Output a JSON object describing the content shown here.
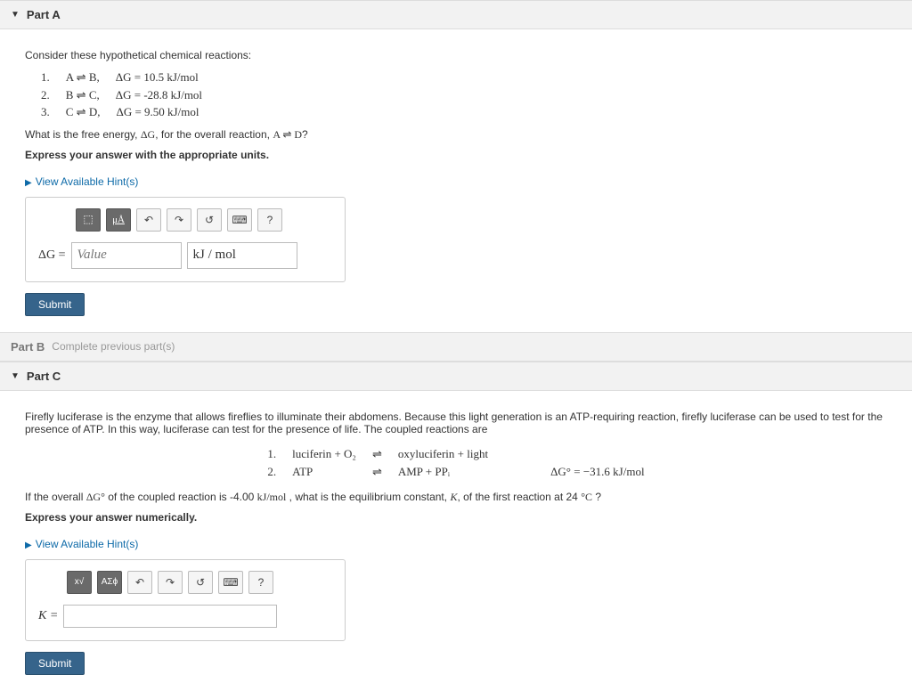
{
  "partA": {
    "title": "Part A",
    "intro": "Consider these hypothetical chemical reactions:",
    "reactions": [
      {
        "num": "1.",
        "lhs": "A ⇌ B,",
        "dg": "ΔG = 10.5 kJ/mol"
      },
      {
        "num": "2.",
        "lhs": "B ⇌ C,",
        "dg": "ΔG = -28.8 kJ/mol"
      },
      {
        "num": "3.",
        "lhs": "C ⇌ D,",
        "dg": "ΔG = 9.50 kJ/mol"
      }
    ],
    "question_pre": "What is the free energy, ",
    "question_var": "ΔG",
    "question_mid": ", for the overall reaction, ",
    "question_rxn": "A ⇌ D",
    "question_post": "?",
    "instruction": "Express your answer with the appropriate units.",
    "hints": "View Available Hint(s)",
    "toolbar": {
      "templates": "⬚",
      "units": "μÅ",
      "undo": "↶",
      "redo": "↷",
      "reset": "↺",
      "keyboard": "⌨",
      "help": "?"
    },
    "answer_lhs": "ΔG = ",
    "value_placeholder": "Value",
    "unit_value": "kJ / mol",
    "submit": "Submit"
  },
  "partB": {
    "title": "Part B",
    "status": "Complete previous part(s)"
  },
  "partC": {
    "title": "Part C",
    "intro": "Firefly luciferase is the enzyme that allows fireflies to illuminate their abdomens. Because this light generation is an ATP-requiring reaction, firefly luciferase can be used to test for the presence of ATP. In this way, luciferase can test for the presence of life. The coupled reactions are",
    "eq1": {
      "num": "1.",
      "lhs": "luciferin + O₂",
      "arrow": "⇌",
      "rhs": "oxyluciferin + light",
      "dg": ""
    },
    "eq2": {
      "num": "2.",
      "lhs": "ATP",
      "arrow": "⇌",
      "rhs": "AMP + PPᵢ",
      "dg": "ΔG° = −31.6 kJ/mol"
    },
    "question_a": "If the overall ",
    "question_b": "ΔG°",
    "question_c": " of the coupled reaction is -4.00 ",
    "question_d": "kJ/mol",
    "question_e": " , what is the equilibrium constant, ",
    "question_f": "K",
    "question_g": ", of the first reaction at 24 ",
    "question_h": "°C",
    "question_i": " ?",
    "instruction": "Express your answer numerically.",
    "hints": "View Available Hint(s)",
    "toolbar": {
      "sqrt": "x√",
      "greek": "ΑΣϕ",
      "undo": "↶",
      "redo": "↷",
      "reset": "↺",
      "keyboard": "⌨",
      "help": "?"
    },
    "answer_lhs": "K = ",
    "submit": "Submit"
  }
}
